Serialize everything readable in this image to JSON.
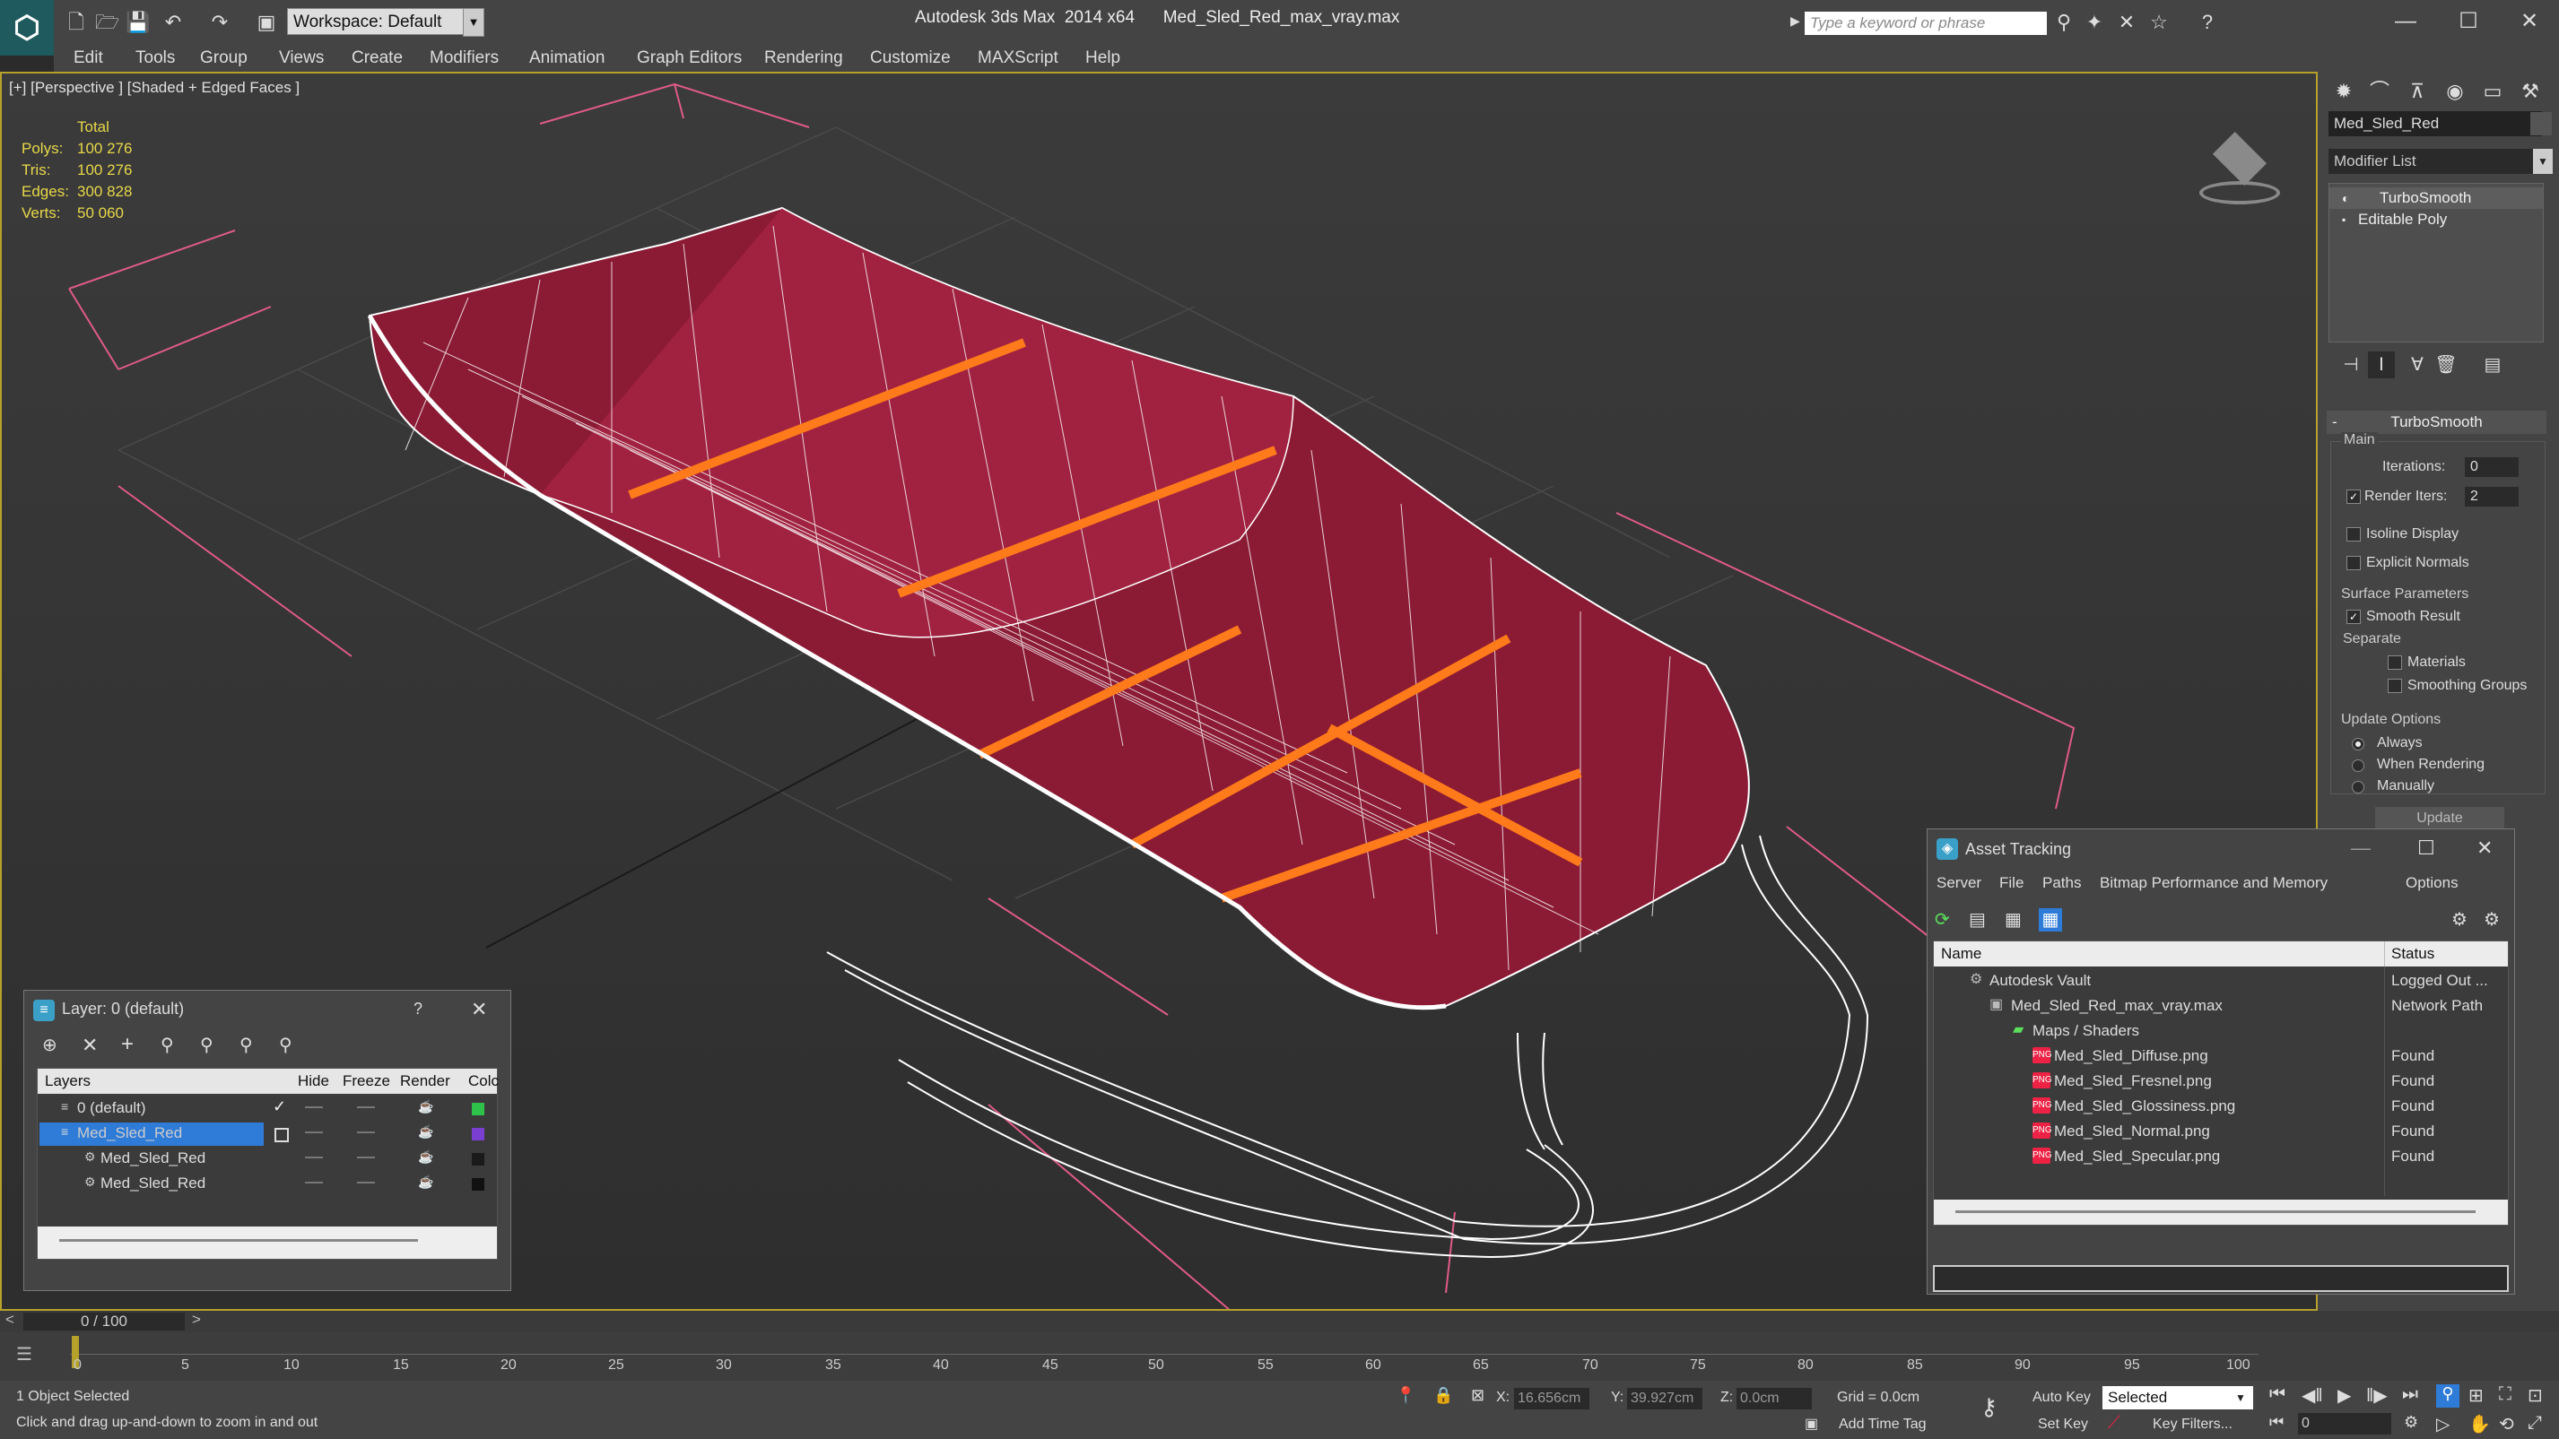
{
  "titlebar": {
    "workspace": "Workspace: Default",
    "app_title": "Autodesk 3ds Max  2014 x64      Med_Sled_Red_max_vray.max",
    "search_placeholder": "Type a keyword or phrase"
  },
  "menu": [
    "Edit",
    "Tools",
    "Group",
    "Views",
    "Create",
    "Modifiers",
    "Animation",
    "Graph Editors",
    "Rendering",
    "Customize",
    "MAXScript",
    "Help"
  ],
  "viewport": {
    "label": "[+] [Perspective ] [Shaded + Edged Faces ]",
    "stats": {
      "header": "Total",
      "rows": [
        {
          "label": "Polys:",
          "value": "100 276"
        },
        {
          "label": "Tris:",
          "value": "100 276"
        },
        {
          "label": "Edges:",
          "value": "300 828"
        },
        {
          "label": "Verts:",
          "value": "50 060"
        }
      ]
    },
    "colors": {
      "mesh": "#8b1a34",
      "wire": "#ffffff",
      "selection": "#ff7a1a",
      "grid_lines": "#e05a8a"
    }
  },
  "command_panel": {
    "object_name": "Med_Sled_Red",
    "modifier_list": "Modifier List",
    "stack": [
      "TurboSmooth",
      "Editable Poly"
    ],
    "rollout_title": "TurboSmooth",
    "main_label": "Main",
    "iterations_label": "Iterations:",
    "iterations_value": "0",
    "render_iters_label": "Render Iters:",
    "render_iters_value": "2",
    "isoline_label": "Isoline Display",
    "explicit_label": "Explicit Normals",
    "surface_params_label": "Surface Parameters",
    "smooth_result_label": "Smooth Result",
    "separate_label": "Separate",
    "materials_label": "Materials",
    "smoothing_groups_label": "Smoothing Groups",
    "update_options_label": "Update Options",
    "always_label": "Always",
    "when_rendering_label": "When Rendering",
    "manually_label": "Manually",
    "update_button": "Update"
  },
  "layer_dialog": {
    "title": "Layer: 0 (default)",
    "help": "?",
    "columns": [
      "Layers",
      "Hide",
      "Freeze",
      "Render",
      "Colc"
    ],
    "rows": [
      {
        "name": "0 (default)",
        "color": "#2ec24a"
      },
      {
        "name": "Med_Sled_Red",
        "color": "#7a3fd0"
      },
      {
        "name": "Med_Sled_Red",
        "color": "#1a1a1a"
      },
      {
        "name": "Med_Sled_Red",
        "color": "#111111"
      }
    ]
  },
  "asset_tracking": {
    "title": "Asset Tracking",
    "menu": [
      "Server",
      "File",
      "Paths",
      "Bitmap Performance and Memory",
      "Options"
    ],
    "columns": [
      "Name",
      "Status"
    ],
    "rows": [
      {
        "name": "Autodesk Vault",
        "status": "Logged Out ..."
      },
      {
        "name": "Med_Sled_Red_max_vray.max",
        "status": "Network Path"
      },
      {
        "name": "Maps / Shaders",
        "status": ""
      },
      {
        "name": "Med_Sled_Diffuse.png",
        "status": "Found"
      },
      {
        "name": "Med_Sled_Fresnel.png",
        "status": "Found"
      },
      {
        "name": "Med_Sled_Glossiness.png",
        "status": "Found"
      },
      {
        "name": "Med_Sled_Normal.png",
        "status": "Found"
      },
      {
        "name": "Med_Sled_Specular.png",
        "status": "Found"
      }
    ],
    "png_icon_text": "PNG"
  },
  "timeline": {
    "frame": "0 / 100",
    "ticks": [
      "0",
      "5",
      "10",
      "15",
      "20",
      "25",
      "30",
      "35",
      "40",
      "45",
      "50",
      "55",
      "60",
      "65",
      "70",
      "75",
      "80",
      "85",
      "90",
      "95",
      "100"
    ]
  },
  "status": {
    "selected": "1 Object Selected",
    "prompt": "Click and drag up-and-down to zoom in and out",
    "x_label": "X:",
    "x_value": "16.656cm",
    "y_label": "Y:",
    "y_value": "39.927cm",
    "z_label": "Z:",
    "z_value": "0.0cm",
    "grid": "Grid = 0.0cm",
    "add_time_tag": "Add Time Tag",
    "auto_key": "Auto Key",
    "set_key": "Set Key",
    "selected_dropdown": "Selected",
    "key_filters": "Key Filters...",
    "frame_field": "0"
  }
}
